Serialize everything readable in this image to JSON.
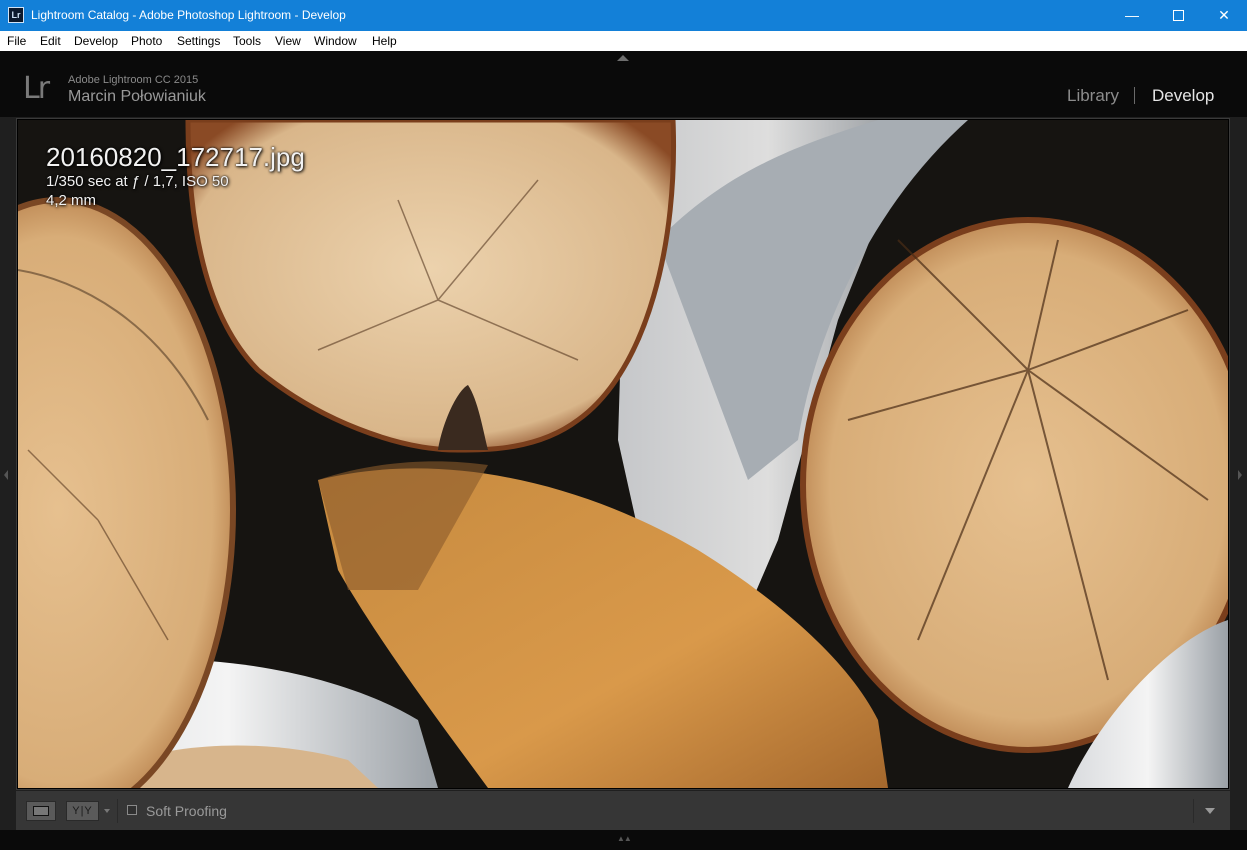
{
  "window": {
    "title": "Lightroom Catalog - Adobe Photoshop Lightroom - Develop",
    "app_icon_text": "Lr",
    "controls": {
      "minimize": "—",
      "maximize": "",
      "close": "✕"
    }
  },
  "menu": {
    "items": [
      "File",
      "Edit",
      "Develop",
      "Photo",
      "Settings",
      "Tools",
      "View",
      "Window",
      "Help"
    ]
  },
  "identity": {
    "logo": "Lr",
    "product": "Adobe Lightroom CC 2015",
    "user": "Marcin Połowianiuk"
  },
  "modules": {
    "library": "Library",
    "develop": "Develop",
    "active": "Develop"
  },
  "photo": {
    "filename": "20160820_172717.jpg",
    "exposure": "1/350 sec at ƒ / 1,7, ISO 50",
    "focal_length": "4,2 mm",
    "subject_icon": "photo-birch-logs"
  },
  "toolbar": {
    "view_mode_icon": "loupe-view-icon",
    "compare_label": "Y|Y",
    "soft_proofing_label": "Soft Proofing",
    "soft_proofing_checked": false
  },
  "colors": {
    "titlebar": "#1380d8",
    "panel_bg": "#0a0a0a",
    "toolbar_bg": "#363636",
    "active_module": "#e6e6e6",
    "inactive_module": "#8c8c8c"
  }
}
